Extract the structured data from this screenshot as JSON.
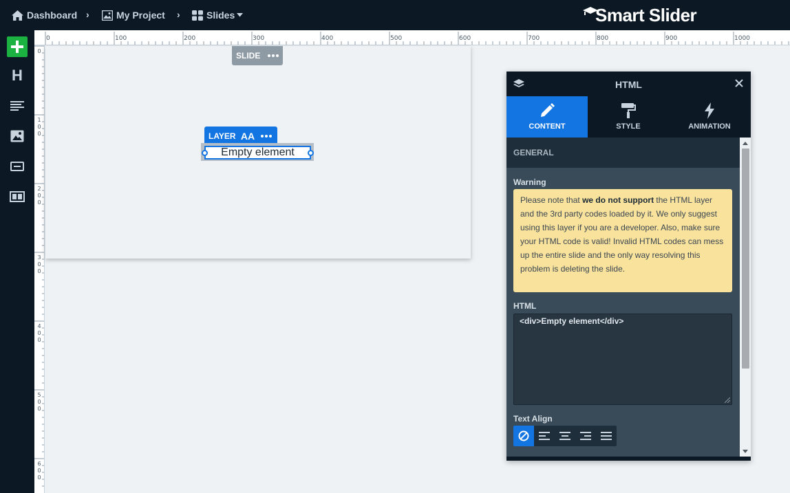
{
  "breadcrumb": {
    "dashboard": "Dashboard",
    "project": "My Project",
    "slides": "Slides"
  },
  "brand": {
    "name": "Smart Slider"
  },
  "toolbar": {
    "items": [
      {
        "icon": "plus-icon"
      },
      {
        "icon": "heading-icon",
        "label": "H"
      },
      {
        "icon": "text-icon"
      },
      {
        "icon": "image-icon"
      },
      {
        "icon": "button-icon"
      },
      {
        "icon": "structure-icon"
      }
    ]
  },
  "ruler": {
    "horizontal": [
      "0",
      "100",
      "200",
      "300",
      "400",
      "500",
      "600",
      "700",
      "800",
      "900",
      "1000"
    ],
    "vertical": [
      "0",
      "100",
      "200",
      "300",
      "400",
      "500",
      "600"
    ]
  },
  "canvas": {
    "slide_tag": "SLIDE",
    "layer_tag": "LAYER",
    "font_icon": "AA",
    "layer_text": "Empty element"
  },
  "panel": {
    "title": "HTML",
    "tabs": [
      {
        "label": "CONTENT",
        "icon": "pencil-icon",
        "active": true
      },
      {
        "label": "STYLE",
        "icon": "paint-roller-icon",
        "active": false
      },
      {
        "label": "ANIMATION",
        "icon": "bolt-icon",
        "active": false
      }
    ],
    "section": "GENERAL",
    "warning_label": "Warning",
    "warning_pre": "Please note that ",
    "warning_bold": "we do not support",
    "warning_post": " the HTML layer and the 3rd party codes loaded by it. We only suggest using this layer if you are a developer. Also, make sure your HTML code is valid! Invalid HTML codes can mess up the entire slide and the only way resolving this problem is deleting the slide.",
    "html_label": "HTML",
    "html_value": "<div>Empty element</div>",
    "text_align_label": "Text Align",
    "align_options": [
      "none",
      "left",
      "center",
      "right",
      "justify"
    ],
    "align_selected": "none"
  },
  "colors": {
    "accent": "#1375e1",
    "add_button": "#1bb241",
    "dark": "#0c1924",
    "warning_bg": "#f9e29c"
  }
}
